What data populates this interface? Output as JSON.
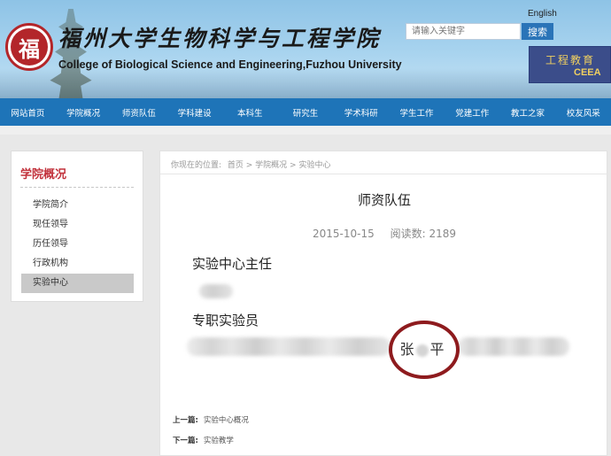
{
  "header": {
    "logo_char": "福",
    "title_cn": "福州大学生物科学与工程学院",
    "title_en": "College of Biological Science and Engineering,Fuzhou University",
    "english_link": "English",
    "search_placeholder": "请输入关键字",
    "search_button": "搜索",
    "banner_cn": "工程教育",
    "banner_en": "CEEA"
  },
  "nav": {
    "items": [
      "网站首页",
      "学院概况",
      "师资队伍",
      "学科建设",
      "本科生",
      "研究生",
      "学术科研",
      "学生工作",
      "党建工作",
      "教工之家",
      "校友风采"
    ]
  },
  "sidebar": {
    "title": "学院概况",
    "items": [
      "学院简介",
      "现任领导",
      "历任领导",
      "行政机构",
      "实验中心"
    ],
    "active_index": 4
  },
  "breadcrumb": {
    "prefix": "你现在的位置:",
    "path": "首页 > 学院概况 > 实验中心"
  },
  "article": {
    "title": "师资队伍",
    "date": "2015-10-15",
    "views_label": "阅读数:",
    "views": "2189",
    "section_director": "实验中心主任",
    "section_staff": "专职实验员",
    "name_first": "张",
    "name_last": "平"
  },
  "pager": {
    "prev_label": "上一篇:",
    "prev_title": "实验中心概况",
    "next_label": "下一篇:",
    "next_title": "实验教学"
  },
  "colors": {
    "nav_blue": "#1e74b8",
    "sidebar_title_red": "#c2323c",
    "circle_red": "#8e1b1e"
  }
}
